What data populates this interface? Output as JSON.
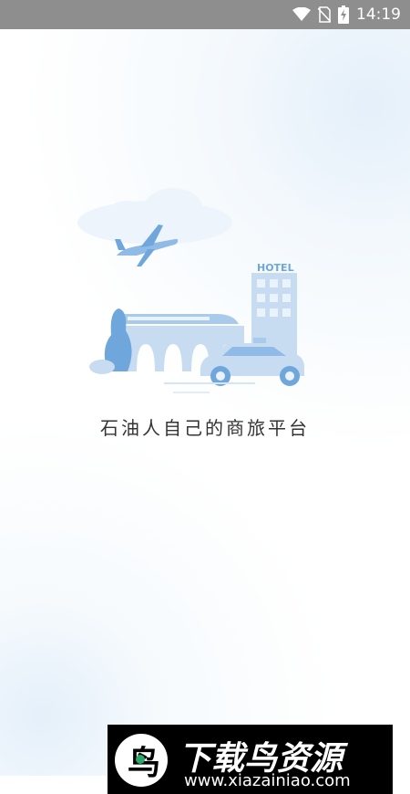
{
  "status_bar": {
    "time": "14:19",
    "icons": [
      "wifi-icon",
      "no-sim-icon",
      "battery-charging-icon"
    ]
  },
  "splash": {
    "hotel_sign": "HOTEL",
    "slogan": "石油人自己的商旅平台"
  },
  "watermark": {
    "title": "下载鸟资源",
    "url": "www.xiazainiao.com"
  },
  "colors": {
    "status_bar_bg": "#8e8e8e",
    "illustration_blue": "#a8cbec",
    "illustration_dark_blue": "#6fa6dc",
    "text": "#333333"
  }
}
